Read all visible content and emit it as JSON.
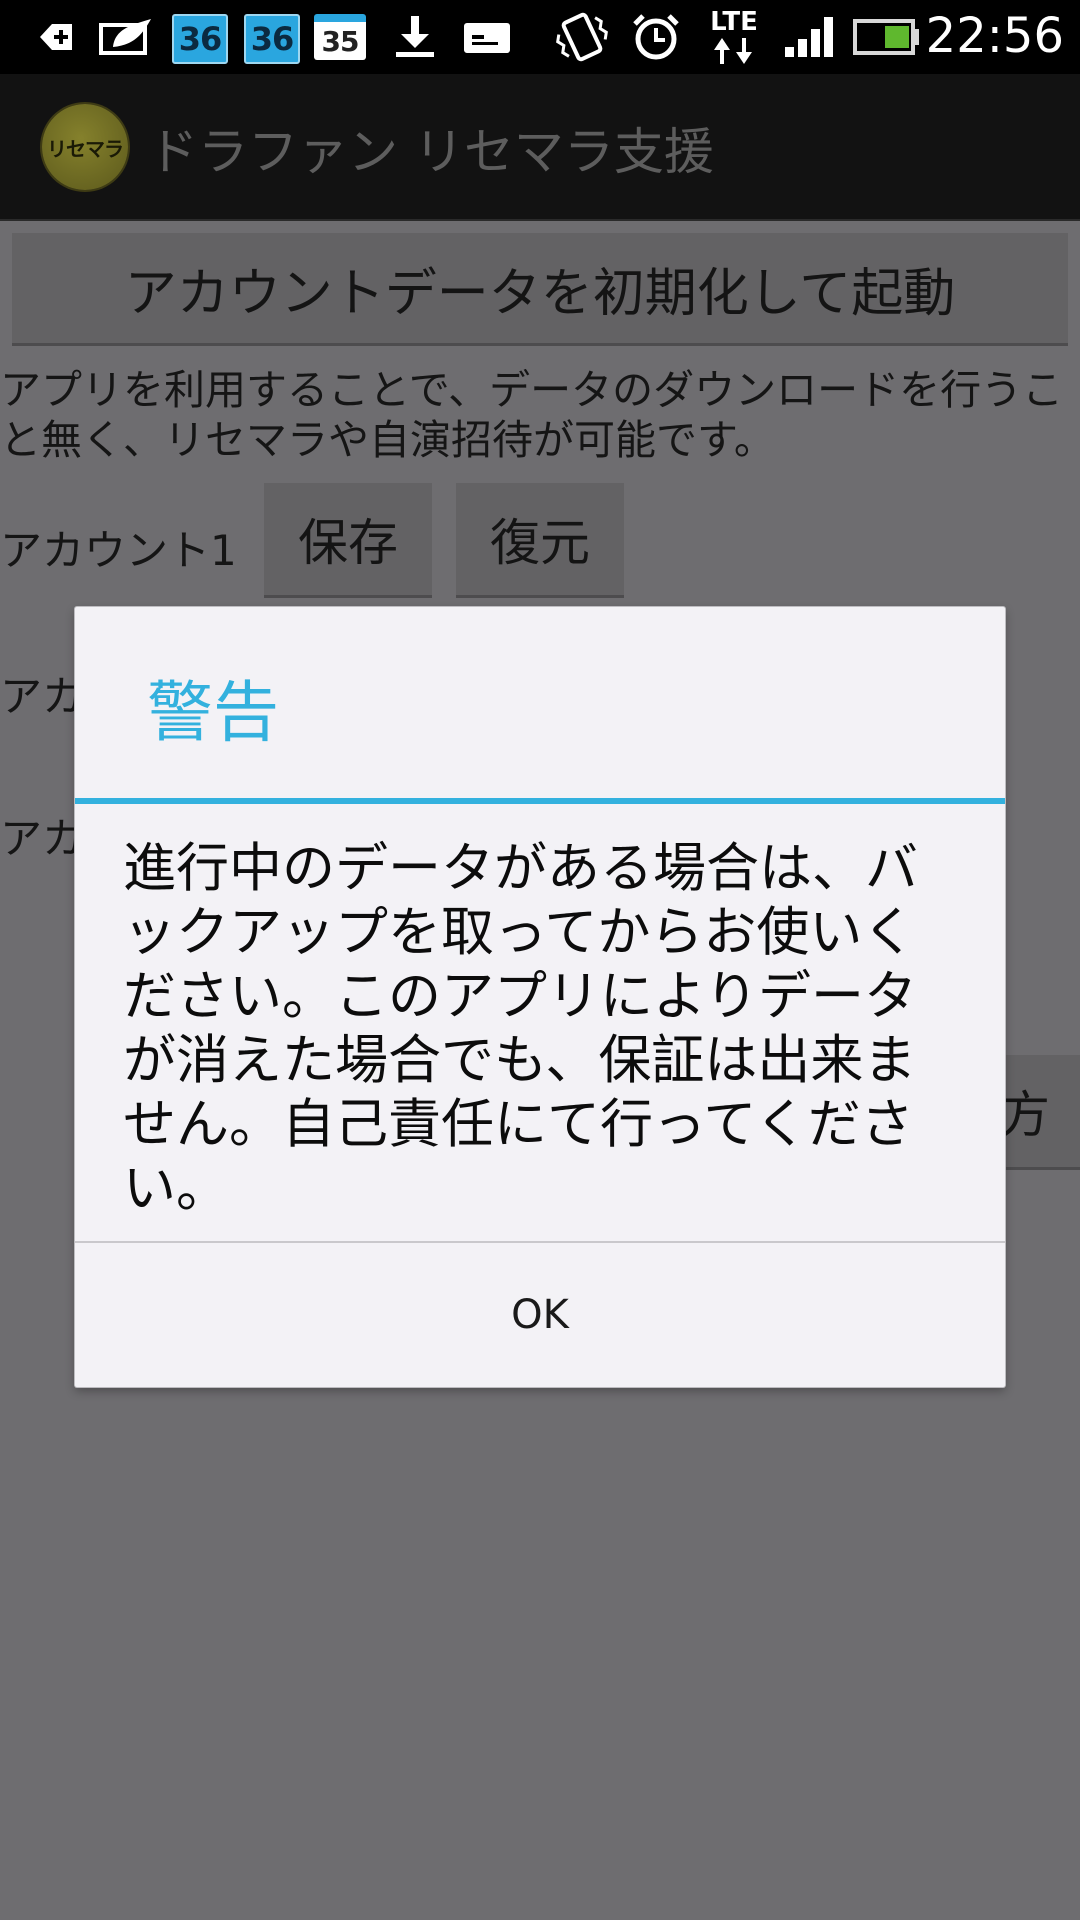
{
  "status_bar": {
    "time": "22:56",
    "calendar_badges": [
      "36",
      "36",
      "35"
    ],
    "network_label": "LTE",
    "icons": [
      "add-notification-icon",
      "eco-icon",
      "calendar-icon",
      "calendar-icon",
      "calendar-icon",
      "download-icon",
      "sim-card-icon",
      "vibrate-icon",
      "alarm-icon",
      "lte-icon",
      "signal-icon",
      "battery-icon"
    ]
  },
  "action_bar": {
    "logo_text": "リセマラ",
    "title": "ドラファン リセマラ支援"
  },
  "main": {
    "init_button_label": "アカウントデータを初期化して起動",
    "description": "アプリを利用することで、データのダウンロードを行うこと無く、リセマラや自演招待が可能です。",
    "accounts": [
      {
        "label": "アカウント1",
        "save_label": "保存",
        "restore_label": "復元"
      },
      {
        "label": "アカ"
      },
      {
        "label": "アカ"
      }
    ],
    "partial_button_label": "方"
  },
  "dialog": {
    "title": "警告",
    "message": "進行中のデータがある場合は、バックアップを取ってからお使いください。このアプリによりデータが消えた場合でも、保証は出来ません。自己責任にて行ってください。",
    "ok_label": "OK"
  },
  "colors": {
    "accent": "#33b1de",
    "status_bar_bg": "#000000",
    "action_bar_bg": "#121212",
    "dim_background": "#6e6d70",
    "dialog_bg": "#f3f2f6"
  }
}
